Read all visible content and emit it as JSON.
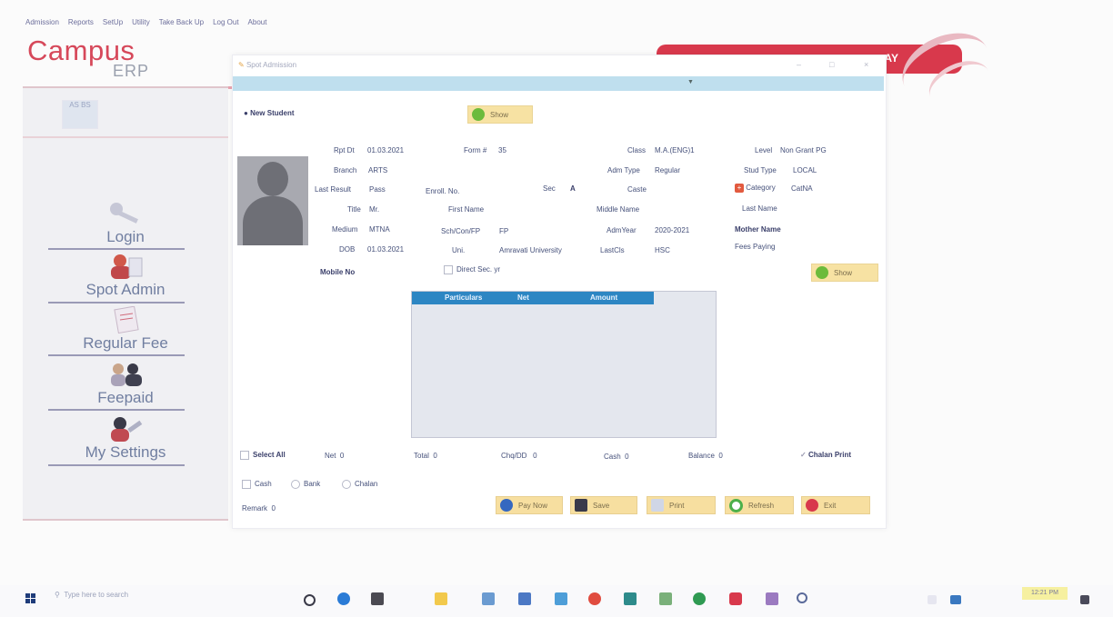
{
  "menu": [
    "Admission",
    "Reports",
    "SetUp",
    "Utility",
    "Take Back Up",
    "Log Out",
    "About"
  ],
  "logo": {
    "main": "Campus",
    "sub": "ERP"
  },
  "banner": {
    "text": "AY"
  },
  "sidebar": {
    "tile": "AS BS",
    "items": [
      {
        "label": "Login",
        "icon": "key-icon"
      },
      {
        "label": "Spot Admin",
        "icon": "users-icon"
      },
      {
        "label": "Regular Fee",
        "icon": "document-icon"
      },
      {
        "label": "Feepaid",
        "icon": "users-icon"
      },
      {
        "label": "My Settings",
        "icon": "user-settings-icon"
      }
    ]
  },
  "dialog": {
    "title": "Spot Admission",
    "controls": {
      "min": "–",
      "max": "□",
      "close": "×"
    },
    "new_student": "New Student",
    "show_label": "Show",
    "fields": {
      "rpt_dt": {
        "label": "Rpt Dt",
        "value": "01.03.2021"
      },
      "form_no": {
        "label": "Form #",
        "value": "35"
      },
      "class": {
        "label": "Class",
        "value": "M.A.(ENG)1"
      },
      "level": {
        "label": "Level",
        "value": "Non Grant PG"
      },
      "branch": {
        "label": "Branch",
        "value": "ARTS"
      },
      "adm_type": {
        "label": "Adm Type",
        "value": "Regular"
      },
      "stud_type": {
        "label": "Stud Type",
        "value": "LOCAL"
      },
      "last_result": {
        "label": "Last Result",
        "value": "Pass"
      },
      "enroll_no": {
        "label": "Enroll. No.",
        "value": ""
      },
      "sec": {
        "label": "Sec",
        "value": "A"
      },
      "caste": {
        "label": "Caste",
        "value": ""
      },
      "category": {
        "label": "Category",
        "value": "CatNA"
      },
      "title": {
        "label": "Title",
        "value": "Mr."
      },
      "first_name": {
        "label": "First Name",
        "value": ""
      },
      "middle_name": {
        "label": "Middle Name",
        "value": ""
      },
      "last_name": {
        "label": "Last Name",
        "value": ""
      },
      "medium": {
        "label": "Medium",
        "value": "MTNA"
      },
      "sch_con_fp": {
        "label": "Sch/Con/FP",
        "value": "FP"
      },
      "adm_year": {
        "label": "AdmYear",
        "value": "2020-2021"
      },
      "mother_name": {
        "label": "Mother Name",
        "value": ""
      },
      "dob": {
        "label": "DOB",
        "value": "01.03.2021"
      },
      "uni": {
        "label": "Uni.",
        "value": "Amravati University"
      },
      "last_cls": {
        "label": "LastCls",
        "value": "HSC"
      },
      "fees_paying": {
        "label": "Fees Paying",
        "value": ""
      },
      "mobile_no": {
        "label": "Mobile No",
        "value": ""
      },
      "direct_sec_yr": {
        "label": "Direct Sec. yr",
        "value": ""
      }
    },
    "table": {
      "columns": [
        "Particulars",
        "Net",
        "Amount"
      ],
      "rows": []
    },
    "totals": {
      "select_all": "Select All",
      "net": {
        "label": "Net",
        "value": "0"
      },
      "total": {
        "label": "Total",
        "value": "0"
      },
      "chq_dd": {
        "label": "Chq/DD",
        "value": "0"
      },
      "cash": {
        "label": "Cash",
        "value": "0"
      },
      "balance": {
        "label": "Balance",
        "value": "0"
      },
      "chalan_print": "Chalan Print"
    },
    "payment_modes": [
      "Cash",
      "Bank",
      "Chalan"
    ],
    "remark": {
      "label": "Remark",
      "value": "0"
    },
    "buttons": [
      "Pay Now",
      "Save",
      "Print",
      "Refresh",
      "Exit"
    ]
  },
  "taskbar": {
    "search_placeholder": "Type here to search",
    "clock": "12:21 PM"
  }
}
